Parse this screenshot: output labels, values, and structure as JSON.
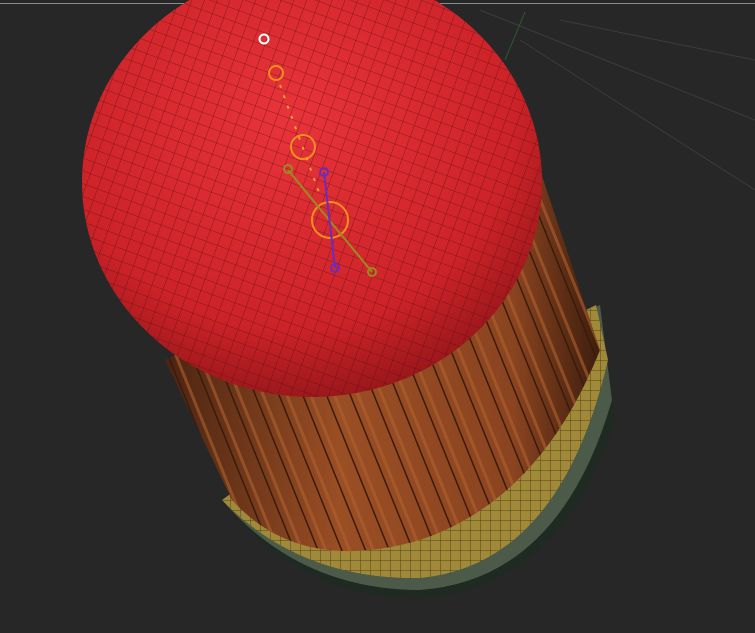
{
  "viewport": {
    "background_color": "#272727",
    "objects": [
      {
        "name": "sphere-mesh",
        "color": "#d42a2e"
      },
      {
        "name": "pleated-cylinder-mesh",
        "color": "#8a4522"
      },
      {
        "name": "base-bowl-mesh",
        "color": "#a08a3a"
      }
    ],
    "gizmo": {
      "colors": {
        "orange": "#f0901c",
        "olive": "#9a8a20",
        "purple": "#6a2cc0",
        "white": "#ffffff"
      },
      "icons": [
        "pivot-circle-icon",
        "rotation-handle-icon",
        "axis-handle-icon"
      ]
    }
  }
}
